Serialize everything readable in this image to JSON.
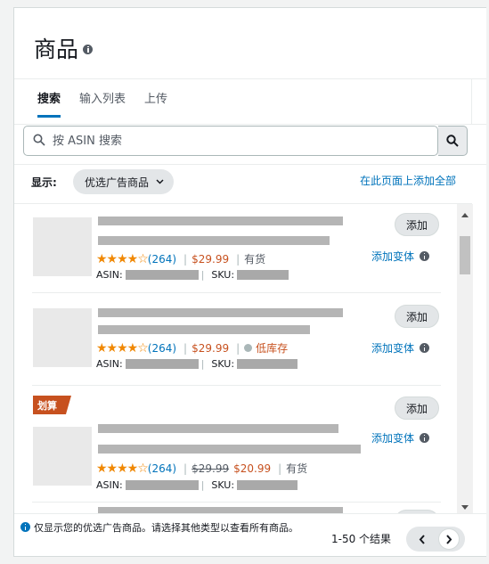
{
  "header": {
    "title": "商品"
  },
  "tabs": [
    {
      "label": "搜索",
      "active": true
    },
    {
      "label": "输入列表",
      "active": false
    },
    {
      "label": "上传",
      "active": false
    }
  ],
  "search": {
    "placeholder": "按 ASIN 搜索",
    "value": ""
  },
  "filter": {
    "show_label": "显示:",
    "selected": "优选广告商品",
    "add_all": "在此页面上添加全部"
  },
  "products": [
    {
      "rating_count": "(264)",
      "price": "$29.99",
      "stock": "有货",
      "asin_label": "ASIN:",
      "sku_label": "SKU:",
      "add_label": "添加",
      "variant_label": "添加变体"
    },
    {
      "rating_count": "(264)",
      "price": "$29.99",
      "stock": "低库存",
      "asin_label": "ASIN:",
      "sku_label": "SKU:",
      "add_label": "添加",
      "variant_label": "添加变体"
    },
    {
      "badge": "划算",
      "rating_count": "(264)",
      "price_old": "$29.99",
      "price": "$20.99",
      "stock": "有货",
      "asin_label": "ASIN:",
      "sku_label": "SKU:",
      "add_label": "添加",
      "variant_label": "添加变体"
    }
  ],
  "footer": {
    "note": "仅显示您的优选广告商品。请选择其他类型以查看所有商品。",
    "results": "1-50 个结果"
  },
  "colors": {
    "accent": "#0073bb",
    "price": "#c7511f",
    "stars": "#f08804",
    "deal_badge": "#c7511f"
  }
}
